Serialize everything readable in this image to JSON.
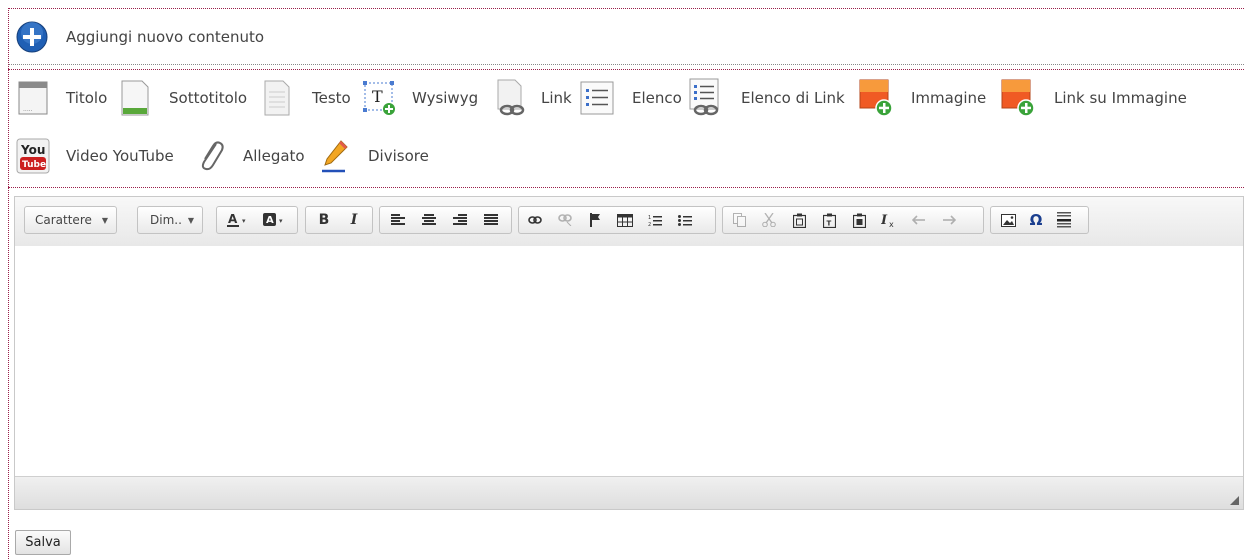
{
  "header": {
    "title": "Aggiungi nuovo contenuto"
  },
  "content_types": [
    {
      "label": "Titolo",
      "icon": "title-block-icon"
    },
    {
      "label": "Sottotitolo",
      "icon": "subtitle-document-icon"
    },
    {
      "label": "Testo",
      "icon": "text-document-icon"
    },
    {
      "label": "Wysiwyg",
      "icon": "wysiwyg-text-icon"
    },
    {
      "label": "Link",
      "icon": "link-document-icon"
    },
    {
      "label": "Elenco",
      "icon": "list-icon"
    },
    {
      "label": "Elenco di Link",
      "icon": "link-list-icon"
    },
    {
      "label": "Immagine",
      "icon": "image-add-icon"
    },
    {
      "label": "Link su Immagine",
      "icon": "image-link-add-icon"
    },
    {
      "label": "Video YouTube",
      "icon": "youtube-icon"
    },
    {
      "label": "Allegato",
      "icon": "paperclip-icon"
    },
    {
      "label": "Divisore",
      "icon": "pencil-icon"
    }
  ],
  "editor": {
    "font_combo": "Carattere",
    "size_combo": "Dim..",
    "bold_glyph": "B",
    "italic_glyph": "I",
    "special_char_glyph": "Ω"
  },
  "save_label": "Salva",
  "colors": {
    "accent_border": "#9a1f4a",
    "plus_blue": "#1f5fb4"
  }
}
